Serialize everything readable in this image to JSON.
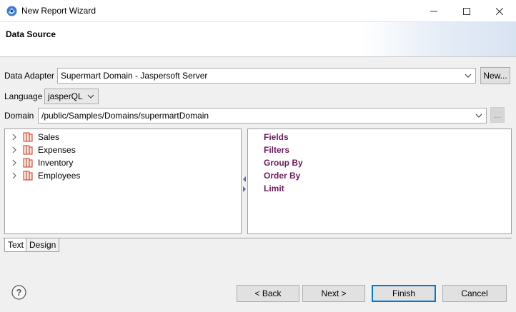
{
  "window": {
    "title": "New Report Wizard",
    "icon": "jaspersoft-studio-icon"
  },
  "header": {
    "title": "Data Source"
  },
  "data_adapter": {
    "label": "Data Adapter",
    "value": "Supermart Domain - Jaspersoft Server",
    "new_button": "New..."
  },
  "language": {
    "label": "Language",
    "value": "jasperQL"
  },
  "domain": {
    "label": "Domain",
    "value": "/public/Samples/Domains/supermartDomain",
    "browse_button": "..."
  },
  "tree": {
    "items": [
      {
        "label": "Sales"
      },
      {
        "label": "Expenses"
      },
      {
        "label": "Inventory"
      },
      {
        "label": "Employees"
      }
    ]
  },
  "query": {
    "clauses": [
      "Fields",
      "Filters",
      "Group By",
      "Order By",
      "Limit"
    ],
    "clause_color": "#6d1b5a"
  },
  "tabs": [
    {
      "label": "Text",
      "active": true
    },
    {
      "label": "Design",
      "active": false
    }
  ],
  "footer": {
    "back": "< Back",
    "next": "Next >",
    "finish": "Finish",
    "cancel": "Cancel"
  },
  "colors": {
    "accent": "#0078d7",
    "folder": "#c0392b"
  }
}
